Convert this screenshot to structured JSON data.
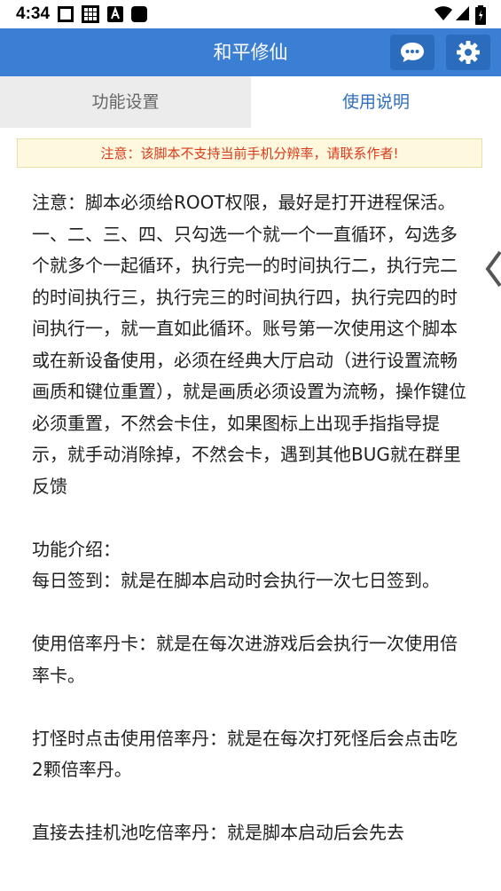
{
  "status_bar": {
    "time": "4:34"
  },
  "app_bar": {
    "title": "和平修仙",
    "chat_icon": "chat-bubble-icon",
    "settings_icon": "gear-icon"
  },
  "tabs": [
    {
      "label": "功能设置",
      "selected": false
    },
    {
      "label": "使用说明",
      "selected": true
    }
  ],
  "notice": "注意：该脚本不支持当前手机分辨率，请联系作者!",
  "instructions": {
    "intro": "注意：脚本必须给ROOT权限，最好是打开进程保活。一、二、三、四、只勾选一个就一个一直循环，勾选多个就多个一起循环，执行完一的时间执行二，执行完二的时间执行三，执行完三的时间执行四，执行完四的时间执行一，就一直如此循环。账号第一次使用这个脚本或在新设备使用，必须在经典大厅启动（进行设置流畅画质和键位重置），就是画质必须设置为流畅，操作键位必须重置，不然会卡住，如果图标上出现手指指导提示，就手动消除掉，不然会卡，遇到其他BUG就在群里反馈",
    "features_heading": "功能介绍：",
    "feature_1": "每日签到：就是在脚本启动时会执行一次七日签到。",
    "feature_2": "使用倍率丹卡：就是在每次进游戏后会执行一次使用倍率卡。",
    "feature_3": "打怪时点击使用倍率丹：就是在每次打死怪后会点击吃2颗倍率丹。",
    "feature_4": "直接去挂机池吃倍率丹：就是脚本启动后会先去"
  },
  "colors": {
    "app_bar": "#3b7fd4",
    "app_bar_button": "#2c6cbd",
    "selected_tab_text": "#2f6fc0",
    "notice_text": "#d93a1c",
    "notice_bg": "#fdf8de"
  }
}
